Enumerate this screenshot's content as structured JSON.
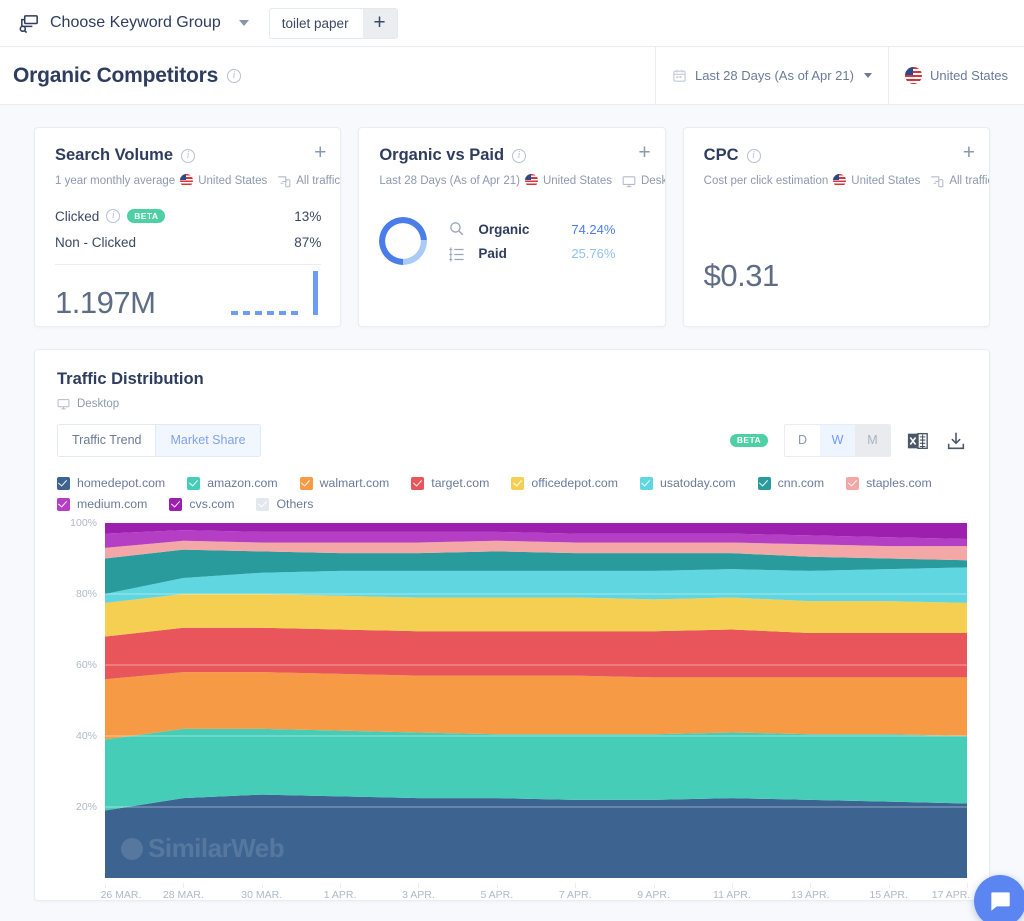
{
  "keyword_bar": {
    "group_label": "Choose Keyword Group",
    "keyword": "toilet paper",
    "add_label": "+",
    "icon": "keyword-search-icon"
  },
  "header": {
    "title": "Organic Competitors",
    "date_range": "Last 28 Days (As of Apr 21)",
    "country": "United States"
  },
  "kpis": {
    "search_volume": {
      "title": "Search Volume",
      "subtitle": "1 year monthly average",
      "country": "United States",
      "traffic": "All traffic",
      "plus": "+",
      "rows": [
        {
          "label": "Clicked",
          "badge": "BETA",
          "value": "13%"
        },
        {
          "label": "Non - Clicked",
          "badge": "",
          "value": "87%"
        }
      ],
      "total": "1.197M"
    },
    "organic_vs_paid": {
      "title": "Organic vs Paid",
      "subtitle": "Last 28 Days (As of Apr 21)",
      "country": "United States",
      "device": "Desktop",
      "plus": "+",
      "organic_label": "Organic",
      "organic_value": "74.24%",
      "paid_label": "Paid",
      "paid_value": "25.76%",
      "organic_color": "#4a7dea",
      "paid_color": "#a9cbf6"
    },
    "cpc": {
      "title": "CPC",
      "subtitle": "Cost per click estimation",
      "country": "United States",
      "traffic": "All traffic",
      "plus": "+",
      "value": "$0.31"
    }
  },
  "traffic_distribution": {
    "title": "Traffic Distribution",
    "device": "Desktop",
    "tabs": [
      {
        "label": "Traffic Trend",
        "active": false
      },
      {
        "label": "Market Share",
        "active": true
      }
    ],
    "beta_badge": "BETA",
    "granularity": [
      {
        "label": "D",
        "state": "normal"
      },
      {
        "label": "W",
        "state": "selected"
      },
      {
        "label": "M",
        "state": "disabled"
      }
    ],
    "excel_icon": "excel-export-icon",
    "download_icon": "download-icon",
    "watermark": "SimilarWeb"
  },
  "chart_data": {
    "type": "area",
    "title": "Traffic Distribution",
    "stacked": true,
    "normalized": true,
    "ylabel": "",
    "xlabel": "",
    "ylim": [
      0,
      100
    ],
    "yticks": [
      "20%",
      "40%",
      "60%",
      "80%",
      "100%"
    ],
    "ytick_values": [
      20,
      40,
      60,
      80,
      100
    ],
    "grid": true,
    "legend_position": "top",
    "x": [
      "26 MAR.",
      "28 MAR.",
      "30 MAR.",
      "1 APR.",
      "3 APR.",
      "5 APR.",
      "7 APR.",
      "9 APR.",
      "11 APR.",
      "13 APR.",
      "15 APR.",
      "17 APR."
    ],
    "series": [
      {
        "name": "homedepot.com",
        "color": "#3d6390",
        "checked": true,
        "values": [
          19.0,
          22.5,
          23.5,
          23.0,
          22.5,
          22.5,
          22.0,
          22.0,
          22.5,
          22.0,
          21.5,
          21.0
        ]
      },
      {
        "name": "amazon.com",
        "color": "#45cdb8",
        "checked": true,
        "values": [
          20.0,
          19.5,
          18.5,
          18.5,
          18.5,
          18.0,
          18.5,
          18.5,
          18.5,
          18.5,
          19.0,
          19.0
        ]
      },
      {
        "name": "walmart.com",
        "color": "#f79a45",
        "checked": true,
        "values": [
          17.0,
          16.0,
          16.0,
          16.0,
          16.0,
          16.5,
          16.5,
          16.0,
          15.5,
          16.0,
          16.0,
          16.5
        ]
      },
      {
        "name": "target.com",
        "color": "#e8555a",
        "checked": true,
        "values": [
          12.0,
          12.5,
          12.5,
          12.5,
          12.5,
          12.5,
          12.5,
          13.0,
          13.5,
          12.5,
          12.5,
          12.5
        ]
      },
      {
        "name": "officedepot.com",
        "color": "#f5cf52",
        "checked": true,
        "values": [
          9.5,
          9.5,
          9.5,
          9.5,
          9.5,
          9.5,
          9.5,
          9.0,
          9.0,
          9.0,
          9.0,
          8.5
        ]
      },
      {
        "name": "usatoday.com",
        "color": "#5fd6e0",
        "checked": true,
        "values": [
          2.5,
          4.5,
          6.0,
          7.0,
          7.5,
          7.5,
          7.5,
          8.0,
          8.0,
          8.5,
          9.0,
          10.0
        ]
      },
      {
        "name": "cnn.com",
        "color": "#2a9b9d",
        "checked": true,
        "values": [
          10.0,
          8.0,
          6.0,
          5.0,
          5.0,
          5.5,
          5.0,
          5.0,
          4.5,
          4.0,
          3.0,
          2.0
        ]
      },
      {
        "name": "staples.com",
        "color": "#f3a7a7",
        "checked": true,
        "values": [
          3.0,
          2.5,
          2.5,
          3.0,
          3.0,
          3.0,
          3.0,
          3.0,
          3.0,
          3.5,
          3.5,
          4.0
        ]
      },
      {
        "name": "medium.com",
        "color": "#b43ec4",
        "checked": true,
        "values": [
          4.0,
          3.0,
          3.0,
          3.0,
          3.0,
          2.5,
          2.5,
          2.5,
          2.5,
          2.5,
          2.5,
          2.0
        ]
      },
      {
        "name": "cvs.com",
        "color": "#9c1fae",
        "checked": true,
        "values": [
          3.0,
          2.0,
          2.5,
          2.5,
          2.5,
          2.5,
          3.0,
          3.0,
          3.0,
          3.5,
          4.0,
          4.5
        ]
      },
      {
        "name": "Others",
        "color": "#e3e7ee",
        "checked": false,
        "values": [
          0,
          0,
          0,
          0,
          0,
          0,
          0,
          0,
          0,
          0,
          0,
          0
        ]
      }
    ]
  }
}
